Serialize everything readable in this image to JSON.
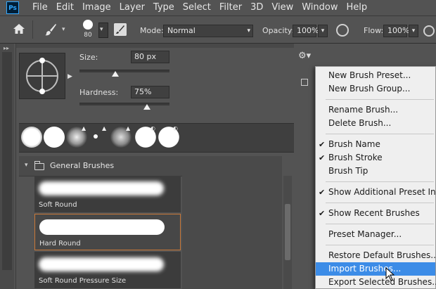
{
  "menubar": {
    "logo": "Ps",
    "items": [
      "File",
      "Edit",
      "Image",
      "Layer",
      "Type",
      "Select",
      "Filter",
      "3D",
      "View",
      "Window",
      "Help"
    ]
  },
  "options": {
    "brush_size": "80",
    "mode_label": "Mode:",
    "mode_value": "Normal",
    "opacity_label": "Opacity:",
    "opacity_value": "100%",
    "flow_label": "Flow:",
    "flow_value": "100%"
  },
  "panel": {
    "size_label": "Size:",
    "size_value": "80 px",
    "size_fraction": 0.4,
    "hardness_label": "Hardness:",
    "hardness_value": "75%",
    "hardness_fraction": 0.75,
    "group_name": "General Brushes",
    "brushes": [
      {
        "name": "Soft Round",
        "selected": false
      },
      {
        "name": "Hard Round",
        "selected": true
      },
      {
        "name": "Soft Round Pressure Size",
        "selected": false
      }
    ]
  },
  "context_menu": {
    "groups": [
      [
        {
          "label": "New Brush Preset...",
          "checked": false
        },
        {
          "label": "New Brush Group...",
          "checked": false
        }
      ],
      [
        {
          "label": "Rename Brush...",
          "checked": false
        },
        {
          "label": "Delete Brush...",
          "checked": false
        }
      ],
      [
        {
          "label": "Brush Name",
          "checked": true
        },
        {
          "label": "Brush Stroke",
          "checked": true
        },
        {
          "label": "Brush Tip",
          "checked": false
        }
      ],
      [
        {
          "label": "Show Additional Preset Info",
          "checked": true
        }
      ],
      [
        {
          "label": "Show Recent Brushes",
          "checked": true
        }
      ],
      [
        {
          "label": "Preset Manager...",
          "checked": false
        }
      ],
      [
        {
          "label": "Restore Default Brushes...",
          "checked": false
        },
        {
          "label": "Import Brushes...",
          "checked": false,
          "highlighted": true
        },
        {
          "label": "Export Selected Brushes...",
          "checked": false
        }
      ]
    ],
    "checkmark": "✔"
  },
  "colors": {
    "highlight": "#3c8ce7",
    "selection_border": "#c87838"
  },
  "icons": {
    "home": "home-icon",
    "brush": "brush-icon",
    "gear": "gear-icon",
    "airbrush": "airbrush-icon"
  }
}
